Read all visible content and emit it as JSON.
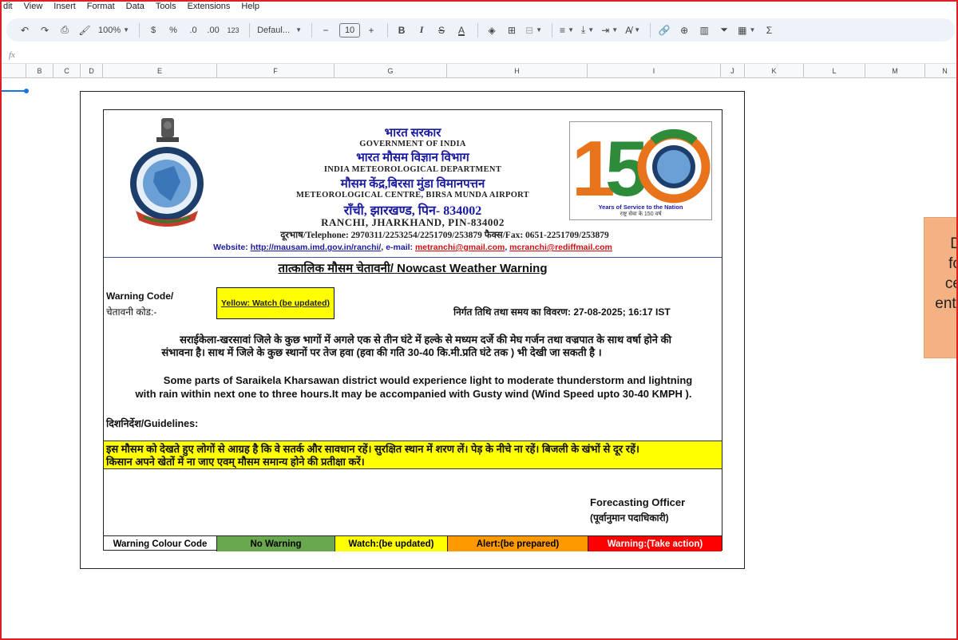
{
  "menu": [
    "dit",
    "View",
    "Insert",
    "Format",
    "Data",
    "Tools",
    "Extensions",
    "Help"
  ],
  "toolbar": {
    "undo_icon": "undo-icon",
    "redo_icon": "redo-icon",
    "print_icon": "print-icon",
    "paint_format_icon": "paint-format-icon",
    "zoom": "100%",
    "currency": "$",
    "percent": "%",
    "dec_decrease": ".0",
    "dec_increase": ".00",
    "number_format": "123",
    "font": "Defaul...",
    "minus": "−",
    "font_size": "10",
    "plus": "+",
    "bold": "B",
    "italic": "I",
    "strike": "S",
    "text_color": "A",
    "sigma": "Σ"
  },
  "formula_bar": {
    "fx": "fx"
  },
  "columns": [
    "B",
    "C",
    "D",
    "E",
    "F",
    "G",
    "H",
    "I",
    "J",
    "K",
    "L",
    "M",
    "N"
  ],
  "bulletin": {
    "hi_govt": "भारत सरकार",
    "en_govt": "GOVERNMENT OF INDIA",
    "hi_imd": "भारत मौसम विज्ञान विभाग",
    "en_imd": "INDIA METEOROLOGICAL DEPARTMENT",
    "hi_centre": "मौसम केंद्र,बिरसा मुंडा विमानपत्तन",
    "en_centre": "METEOROLOGICAL CENTRE, BIRSA MUNDA AIRPORT",
    "hi_city": "राँची, झारखण्ड, पिन- 834002",
    "en_city": "RANCHI, JHARKHAND, PIN-834002",
    "phone_line": "दूरभाष/Telephone: 2970311/2253254/2251709/253879   फैक्स/Fax: 0651-2251709/253879",
    "website_label": "Website:",
    "website": "http://mausam.imd.gov.in/ranchi/",
    "email_label": ",   e-mail:",
    "email1": "metranchi@gmail.com",
    "email2": "mcranchi@rediffmail.com",
    "logo_years": "Years of Service to the Nation",
    "logo_hindi": "राष्ट्र सेवा के 150 वर्ष",
    "logo_big": "150",
    "title": "तात्कालिक मौसम चेतावनी/ Nowcast Weather Warning",
    "warning_code_en": "Warning Code/",
    "warning_code_hi": "चेतावनी कोड:-",
    "code_value": "Yellow: Watch (be updated)",
    "issue_time": "निर्गत तिथि तथा समय का विवरण: 27-08-2025; 16:17 IST",
    "hindi_para_1": "सराईकेला-खरसावां जिले के  कुछ भागों में अगले एक से तीन घंटे में हल्के से मध्यम दर्जे की मेघ गर्जन तथा वज्रपात के साथ वर्षा  होने की",
    "hindi_para_2": "संभावना है। साथ में जिले के कुछ स्थानों पर तेज हवा (हवा की गति 30-40 कि.मी.प्रति घंटे तक ) भी देखी जा सकती है ।",
    "en_para_1": "Some parts of Saraikela Kharsawan district would experience light to moderate thunderstorm and lightning",
    "en_para_2": "with rain  within next one to three hours.It may be accompanied with Gusty wind (Wind Speed  upto 30-40 KMPH ).",
    "guidelines": "दिशनिर्देश/Guidelines:",
    "guide_1": "इस मौसम को देखते हुए लोगों से आग्रह है कि वे सतर्क और सावधान रहें। सुरक्षित स्थान में शरण लें। पेड़ के नीचे ना रहें। बिजली के खंभों से दूर रहें।",
    "guide_2": "किसान अपने खेतों में ना जाए एवम् मौसम समान्य होने की प्रतीक्षा करें।",
    "officer_en": "Forecasting Officer",
    "officer_hi": "(पूर्वानुमान पदाधिकारी)",
    "legend": [
      {
        "label": "Warning Colour Code",
        "color": "#ffffff"
      },
      {
        "label": "No Warning",
        "color": "#6aa84f"
      },
      {
        "label": "Watch:(be updated)",
        "color": "#ffff00"
      },
      {
        "label": "Alert:(be prepared)",
        "color": "#ff9900"
      },
      {
        "label": "Warning:(Take action)",
        "color": "#ff0000"
      }
    ]
  },
  "side_card": [
    "D",
    "fo",
    "ce",
    "entr"
  ]
}
